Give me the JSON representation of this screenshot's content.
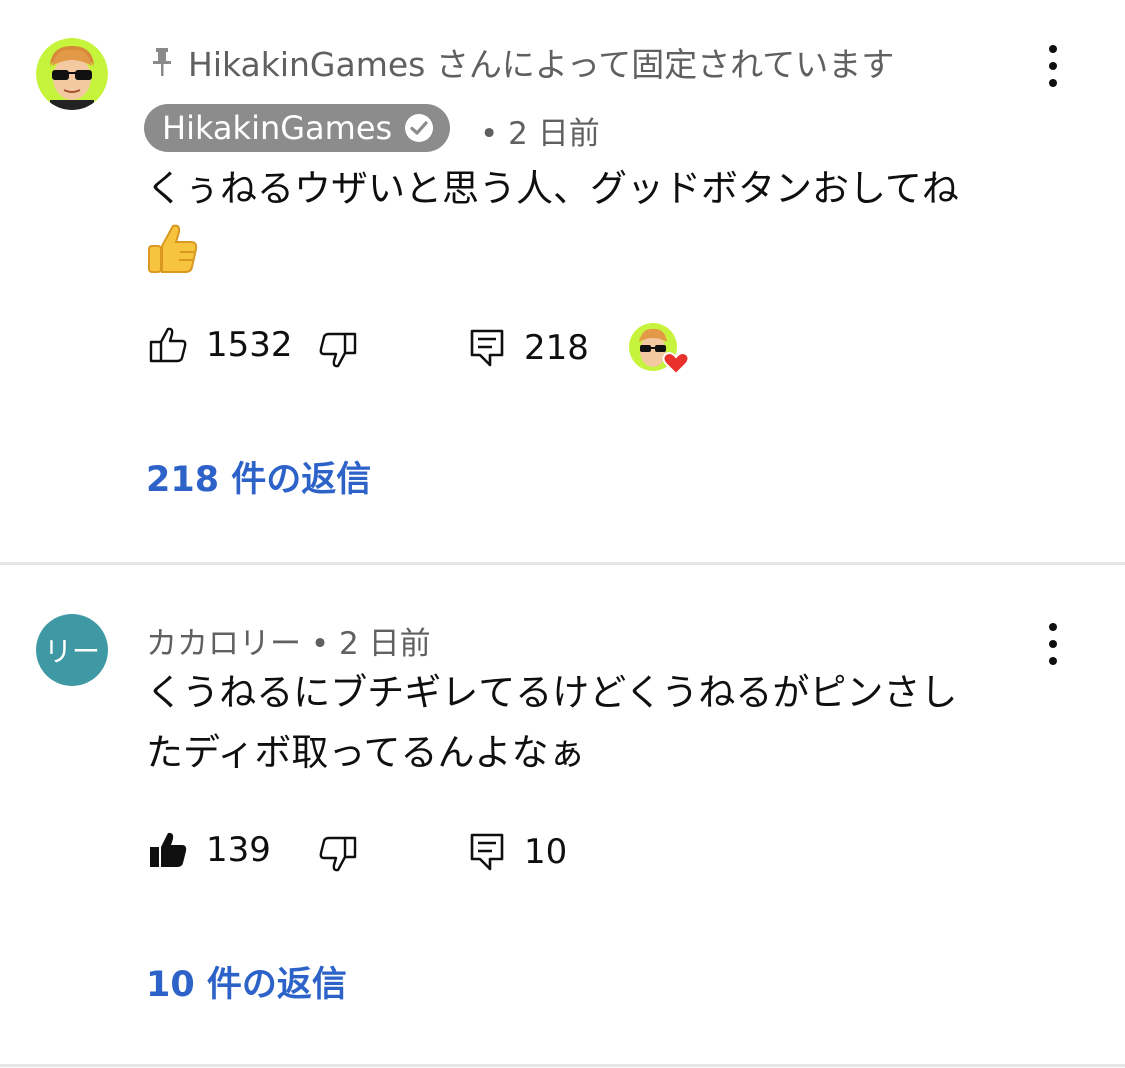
{
  "comments": [
    {
      "pinned_text": "HikakinGames さんによって固定されています",
      "author": "HikakinGames",
      "time": "• 2 日前",
      "text_lines": [
        "くぅねるウザいと思う人、グッドボタンおしてね",
        "👍"
      ],
      "likes": "1532",
      "reply_count": "218",
      "replies_link": "218 件の返信",
      "creator_hearted": true
    },
    {
      "author": "カカロリー • 2 日前",
      "avatar_letter": "リー",
      "avatar_color": "#3f99a4",
      "text_lines": [
        "くうねるにブチギレてるけどくうねるがピンさし",
        "たディボ取ってるんよなぁ"
      ],
      "likes": "139",
      "liked": true,
      "reply_count": "10",
      "replies_link": "10 件の返信"
    }
  ],
  "colors": {
    "link": "#2d63c8",
    "badge_bg": "#8c8c8c",
    "heart": "#e8322b",
    "avatar_ring": "#c6f33c"
  }
}
